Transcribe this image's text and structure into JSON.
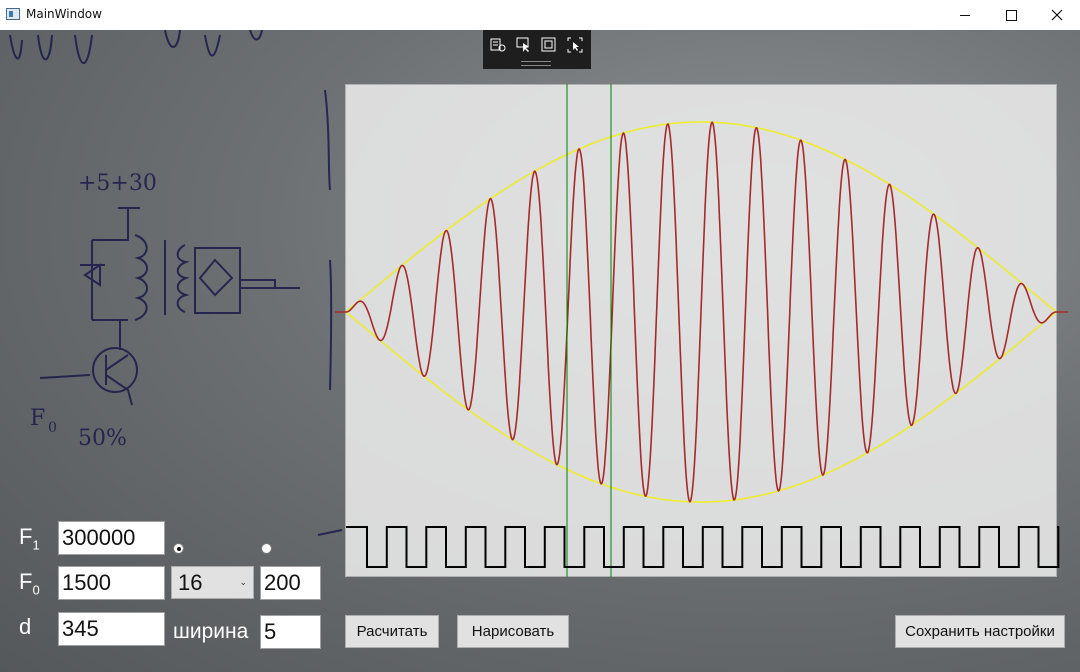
{
  "window": {
    "title": "MainWindow"
  },
  "controls": {
    "f1_label": "F",
    "f1_sub": "1",
    "f1_value": "300000",
    "f0_label": "F",
    "f0_sub": "0",
    "f0_value": "1500",
    "d_label": "d",
    "d_value": "345",
    "dropdown_value": "16",
    "right_value": "200",
    "width_label": "ширина",
    "width_value": "5",
    "radio_left_checked": true,
    "radio_right_checked": false
  },
  "buttons": {
    "calculate": "Расчитать",
    "draw": "Нарисовать",
    "save": "Сохранить настройки"
  },
  "chart_data": {
    "type": "line",
    "series": [
      {
        "color": "#a52a2a",
        "cycles": 16,
        "amplitude_envelope": "sine-half"
      },
      {
        "color": "#f0e000",
        "role": "envelope"
      }
    ],
    "square_wave": {
      "color": "#000000",
      "periods": 18
    },
    "markers": {
      "color": "#008000",
      "count": 2
    },
    "colors": {
      "signal": "#a52a2a",
      "envelope": "#eeee22",
      "marker": "#008000",
      "square": "#000000"
    }
  }
}
